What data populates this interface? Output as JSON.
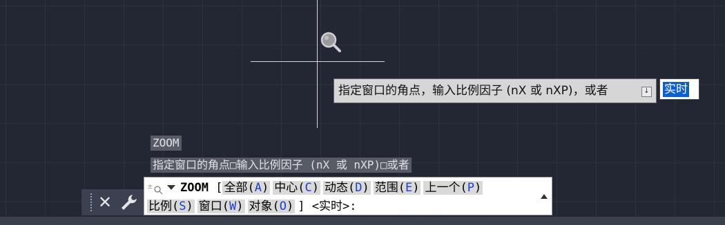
{
  "tooltip": {
    "prompt": "指定窗口的角点，输入比例因子 (nX 或 nXP)，或者",
    "input_value": "实时"
  },
  "history": {
    "line1": "ZOOM",
    "line2": "指定窗口的角点□输入比例因子 (nX 或 nXP)□或者"
  },
  "command": {
    "name": "ZOOM",
    "open_bracket": "[",
    "close_bracket": "]",
    "options": [
      {
        "pre": "全部(",
        "key": "A",
        "post": ")"
      },
      {
        "pre": "中心(",
        "key": "C",
        "post": ")"
      },
      {
        "pre": "动态(",
        "key": "D",
        "post": ")"
      },
      {
        "pre": "范围(",
        "key": "E",
        "post": ")"
      },
      {
        "pre": "上一个(",
        "key": "P",
        "post": ")"
      },
      {
        "pre": "比例(",
        "key": "S",
        "post": ")"
      },
      {
        "pre": "窗口(",
        "key": "W",
        "post": ")"
      },
      {
        "pre": "对象(",
        "key": "O",
        "post": ")"
      }
    ],
    "default": "<实时>:"
  },
  "colors": {
    "background": "#222733",
    "option_key": "#1a3fd1",
    "selection": "#0b5fd1"
  },
  "icons": [
    "magnifier-cursor-icon",
    "dropdown-arrow-icon",
    "close-icon",
    "wrench-icon",
    "command-icon",
    "scroll-up-icon"
  ]
}
